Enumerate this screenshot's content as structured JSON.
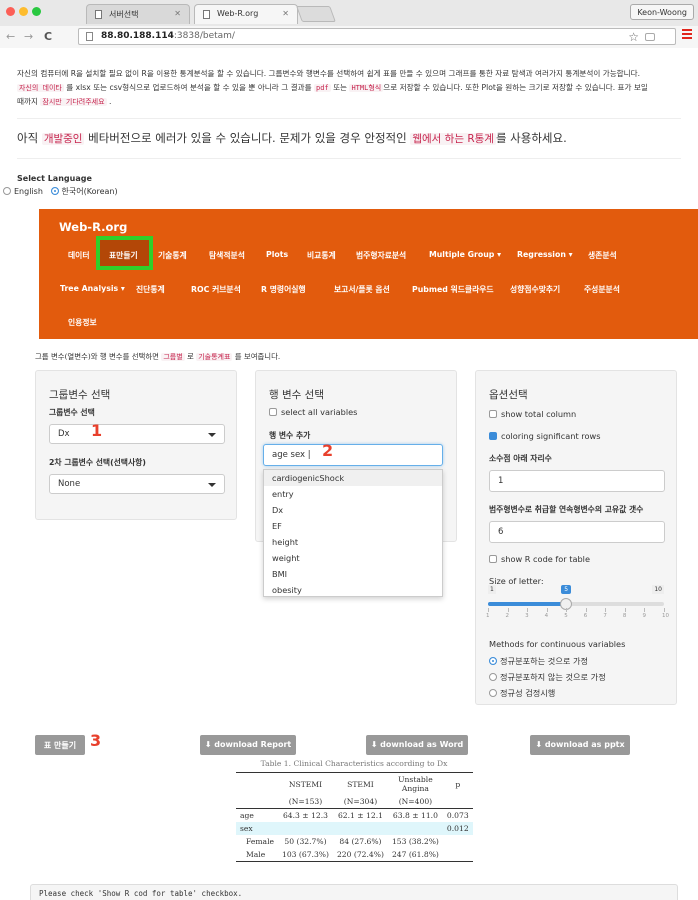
{
  "browser": {
    "tabs": [
      {
        "title": "서버선택"
      },
      {
        "title": "Web-R.org"
      }
    ],
    "user": "Keon-Woong",
    "url_host": "88.80.188.114",
    "url_path": ":3838/betam/"
  },
  "intro": {
    "line1": "자신의 컴퓨터에 R을 설치할 필요 없이 R을 이용한 통계분석을 할 수 있습니다. 그룹변수와 행변수를 선택하여 쉽게 표를 만들 수 있으며 그래프를 통한 자료 탐색과 여러가지 통계분석이 가능합니다.",
    "code1": "자신의 데이타",
    "text2": "를 xlsx 또는 csv형식으로 업로드하여 분석을 할 수 있을 뿐 아니라 그 결과를",
    "code2": "pdf",
    "text3": "또는",
    "code3": "HTML형식",
    "text4": "으로 저장할 수 있습니다. 또한 Plot을 원하는 크기로 저장할 수 있습니다. 표가 보일",
    "text5": "때까지",
    "code4": "잠시만 기다려주세요",
    "text6": "."
  },
  "beta": {
    "pre": "아직",
    "code1": "개발중인",
    "mid": "베타버전으로 에러가 있을 수 있습니다. 문제가 있을 경우 안정적인",
    "code2": "웹에서 하는 R통계",
    "post": "를 사용하세요."
  },
  "language": {
    "label": "Select Language",
    "options": [
      "English",
      "한국어(Korean)"
    ],
    "selected": "한국어(Korean)"
  },
  "navbar": {
    "brand": "Web-R.org",
    "row1": [
      "데이터",
      "표만들기",
      "기술통계",
      "탐색적분석",
      "Plots",
      "비교통계",
      "범주형자료분석",
      "Multiple Group ▾",
      "Regression ▾",
      "생존분석"
    ],
    "row2": [
      "Tree Analysis ▾",
      "진단통계",
      "ROC 커브분석",
      "R 명령어실행",
      "보고서/플롯 옵션",
      "Pubmed 워드클라우드",
      "성향점수맞추기",
      "주성분분석"
    ],
    "row3": [
      "인용정보"
    ],
    "active": "표만들기",
    "bg_color": "#e25b0d"
  },
  "intro2": {
    "text1": "그룹 변수(열변수)와 행 변수를 선택하면",
    "code1": "그룹별",
    "text2": "로",
    "code2": "기술통계표",
    "text3": "를 보여줍니다."
  },
  "panel1": {
    "title": "그룹변수 선택",
    "label1": "그룹변수 선택",
    "select1": "Dx",
    "label2": "2차 그룹변수 선택(선택사항)",
    "select2": "None"
  },
  "panel2": {
    "title": "행 변수 선택",
    "select_all": "select all variables",
    "label": "행 변수 추가",
    "tags": [
      "age",
      "sex"
    ],
    "options": [
      "cardiogenicShock",
      "entry",
      "Dx",
      "EF",
      "height",
      "weight",
      "BMI",
      "obesity"
    ]
  },
  "panel3": {
    "title": "옵션선택",
    "show_total": "show total column",
    "coloring": "coloring significant rows",
    "decimal_label": "소수점 아래 자리수",
    "decimal_value": "1",
    "unique_label": "범주형변수로 취급할 연속형변수의 고유값 갯수",
    "unique_value": "6",
    "show_r": "show R code for table",
    "size_label": "Size of letter:",
    "size_min": "1",
    "size_max": "10",
    "size_value": 5,
    "size_ticks": [
      "1",
      "2",
      "3",
      "4",
      "5",
      "6",
      "7",
      "8",
      "9",
      "10"
    ],
    "methods_label": "Methods for continuous variables",
    "methods": [
      "정규분포하는 것으로 가정",
      "정규분포하지 않는 것으로 가정",
      "정규성 검정시행"
    ],
    "method_selected": 0
  },
  "annotations": [
    "1",
    "2",
    "3"
  ],
  "buttons": {
    "make_table": "표 만들기",
    "report": "⬇ download Report",
    "word": "⬇ download as Word",
    "pptx": "⬇ download as pptx"
  },
  "table": {
    "caption": "Table 1. Clinical Characteristics according to Dx",
    "headers": [
      "",
      "NSTEMI",
      "STEMI",
      "Unstable Angina",
      "p"
    ],
    "subheaders": [
      "",
      "(N=153)",
      "(N=304)",
      "(N=400)",
      ""
    ],
    "rows": [
      [
        "age",
        "64.3 ± 12.3",
        "62.1 ± 12.1",
        "63.8 ± 11.0",
        "0.073"
      ],
      [
        "sex",
        "",
        "",
        "",
        "0.012"
      ],
      [
        "Female",
        "50 (32.7%)",
        "84 (27.6%)",
        "153 (38.2%)",
        ""
      ],
      [
        "Male",
        "103 (67.3%)",
        "220 (72.4%)",
        "247 (61.8%)",
        ""
      ]
    ],
    "highlight_color": "#dff6fb"
  },
  "note": "Please check 'Show R cod for table' checkbox."
}
